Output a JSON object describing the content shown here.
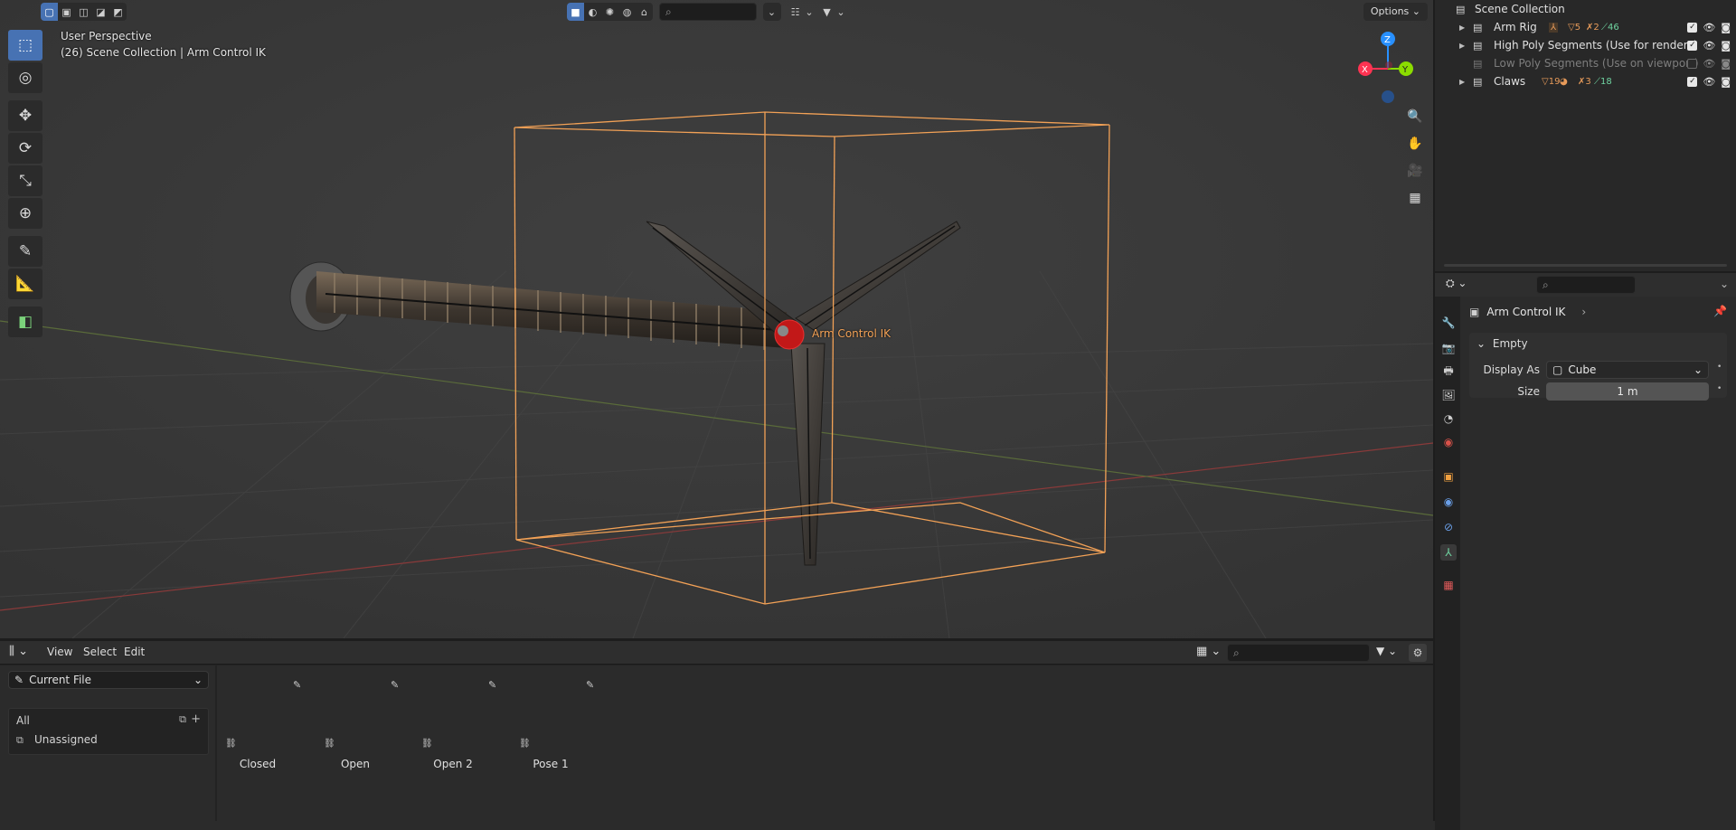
{
  "viewport": {
    "perspective_label": "User Perspective",
    "collection_label": "(26) Scene Collection | Arm Control IK",
    "empty_label": "Arm Control IK",
    "options_label": "Options",
    "gizmo": {
      "x": "X",
      "y": "Y",
      "z": "Z"
    },
    "colors": {
      "selection": "#f2a156",
      "active_tool": "#4772b3",
      "x_axis": "#ff3352",
      "y_axis": "#8bdc00",
      "z_axis": "#2890ff"
    }
  },
  "tools": [
    "select-box",
    "cursor",
    "move",
    "rotate",
    "scale",
    "transform",
    "annotate",
    "measure",
    "add-cube"
  ],
  "bottom_editor": {
    "menu": [
      "View",
      "Select",
      "Edit"
    ],
    "library_dropdown": "Current File",
    "library_list": [
      "All",
      "Unassigned"
    ],
    "poses": [
      "Closed",
      "Open",
      "Open 2",
      "Pose 1"
    ]
  },
  "outliner": {
    "root": "Scene Collection",
    "collections": [
      {
        "name": "Arm Rig",
        "badges": [
          "5",
          "2",
          "46"
        ]
      },
      {
        "name": "High Poly Segments (Use for renders)"
      },
      {
        "name": "Low Poly Segments (Use on viewport)",
        "disabled": true
      },
      {
        "name": "Claws",
        "badges": [
          "19",
          "3",
          "18"
        ]
      }
    ]
  },
  "properties": {
    "object_name": "Arm Control IK",
    "panel_title": "Empty",
    "display_as_label": "Display As",
    "display_as_value": "Cube",
    "size_label": "Size",
    "size_value": "1 m"
  }
}
